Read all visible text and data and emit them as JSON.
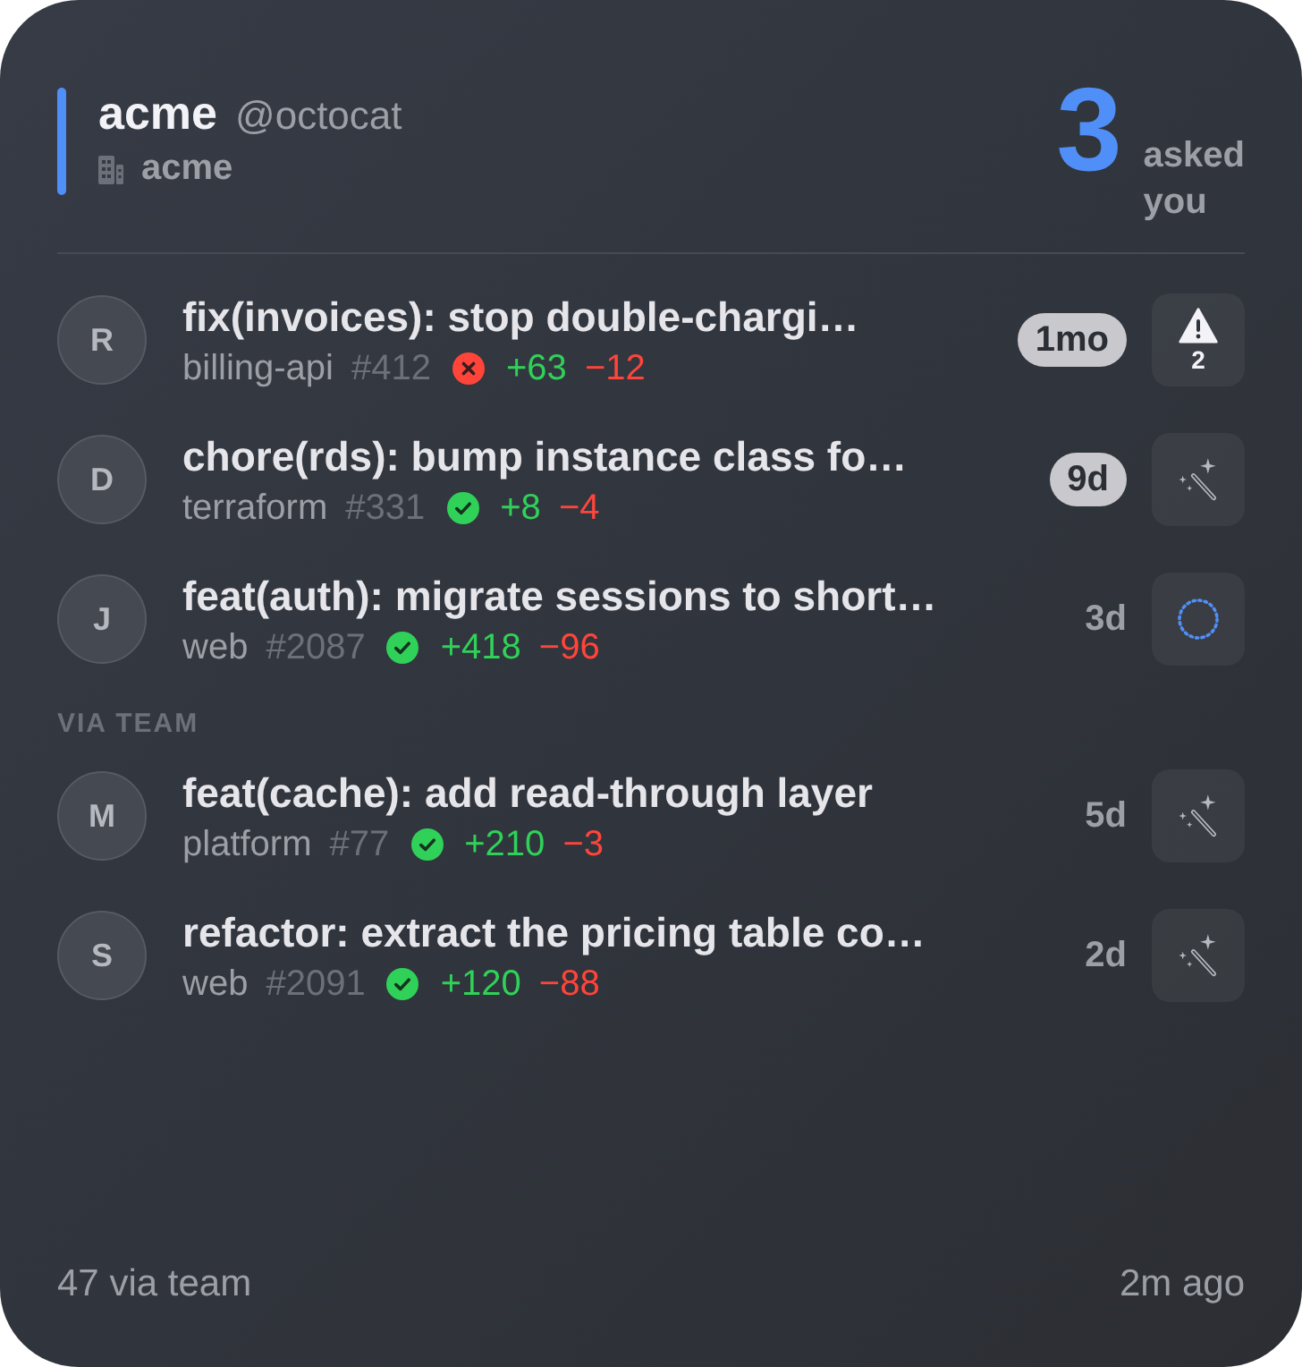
{
  "header": {
    "org": "acme",
    "user": "@octocat",
    "org_label": "acme",
    "count": "3",
    "count_label": "asked you"
  },
  "sections": [
    {
      "items": [
        {
          "avatar": "R",
          "title": "fix(invoices): stop double-chargi…",
          "repo": "billing-api",
          "number": "#412",
          "checks_passed": false,
          "additions": "+63",
          "deletions": "−12",
          "age": "1mo",
          "age_highlighted": true,
          "action": {
            "kind": "warning",
            "count": "2"
          }
        },
        {
          "avatar": "D",
          "title": "chore(rds): bump instance class fo…",
          "repo": "terraform",
          "number": "#331",
          "checks_passed": true,
          "additions": "+8",
          "deletions": "−4",
          "age": "9d",
          "age_highlighted": true,
          "action": {
            "kind": "suggest"
          }
        },
        {
          "avatar": "J",
          "title": "feat(auth): migrate sessions to short…",
          "repo": "web",
          "number": "#2087",
          "checks_passed": true,
          "additions": "+418",
          "deletions": "−96",
          "age": "3d",
          "age_highlighted": false,
          "action": {
            "kind": "pending"
          }
        }
      ]
    },
    {
      "label": "VIA TEAM",
      "items": [
        {
          "avatar": "M",
          "title": "feat(cache): add read-through layer",
          "repo": "platform",
          "number": "#77",
          "checks_passed": true,
          "additions": "+210",
          "deletions": "−3",
          "age": "5d",
          "age_highlighted": false,
          "action": {
            "kind": "suggest"
          }
        },
        {
          "avatar": "S",
          "title": "refactor: extract the pricing table co…",
          "repo": "web",
          "number": "#2091",
          "checks_passed": true,
          "additions": "+120",
          "deletions": "−88",
          "age": "2d",
          "age_highlighted": false,
          "action": {
            "kind": "suggest"
          }
        }
      ]
    }
  ],
  "footer": {
    "left": "47 via team",
    "right": "2m ago"
  }
}
